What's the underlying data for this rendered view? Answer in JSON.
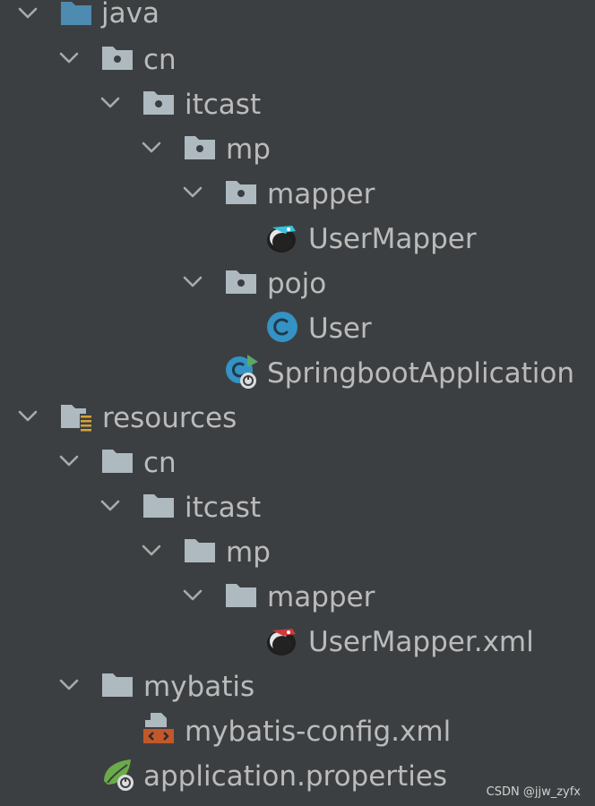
{
  "tree": {
    "items": [
      {
        "label": "java",
        "icon": "source-folder-icon",
        "expanded": true
      },
      {
        "label": "cn",
        "icon": "package-icon",
        "expanded": true
      },
      {
        "label": "itcast",
        "icon": "package-icon",
        "expanded": true
      },
      {
        "label": "mp",
        "icon": "package-icon",
        "expanded": true
      },
      {
        "label": "mapper",
        "icon": "package-icon",
        "expanded": true
      },
      {
        "label": "UserMapper",
        "icon": "mybatis-mapper-interface-icon"
      },
      {
        "label": "pojo",
        "icon": "package-icon",
        "expanded": true
      },
      {
        "label": "User",
        "icon": "class-icon"
      },
      {
        "label": "SpringbootApplication",
        "icon": "spring-boot-application-icon"
      },
      {
        "label": "resources",
        "icon": "resources-folder-icon",
        "expanded": true
      },
      {
        "label": "cn",
        "icon": "folder-icon",
        "expanded": true
      },
      {
        "label": "itcast",
        "icon": "folder-icon",
        "expanded": true
      },
      {
        "label": "mp",
        "icon": "folder-icon",
        "expanded": true
      },
      {
        "label": "mapper",
        "icon": "folder-icon",
        "expanded": true
      },
      {
        "label": "UserMapper.xml",
        "icon": "mybatis-mapper-xml-icon"
      },
      {
        "label": "mybatis",
        "icon": "folder-icon",
        "expanded": true
      },
      {
        "label": "mybatis-config.xml",
        "icon": "xml-file-icon"
      },
      {
        "label": "application.properties",
        "icon": "spring-properties-icon"
      }
    ]
  },
  "watermark": "CSDN @jjw_zyfx",
  "colors": {
    "background": "#3c3f41",
    "text": "#bbbbbb",
    "folder": "#aeb9c0",
    "source_folder": "#4e8bb0",
    "class_icon": "#3592c4",
    "xml_orange": "#c2582a",
    "spring_green": "#6aab4a"
  }
}
